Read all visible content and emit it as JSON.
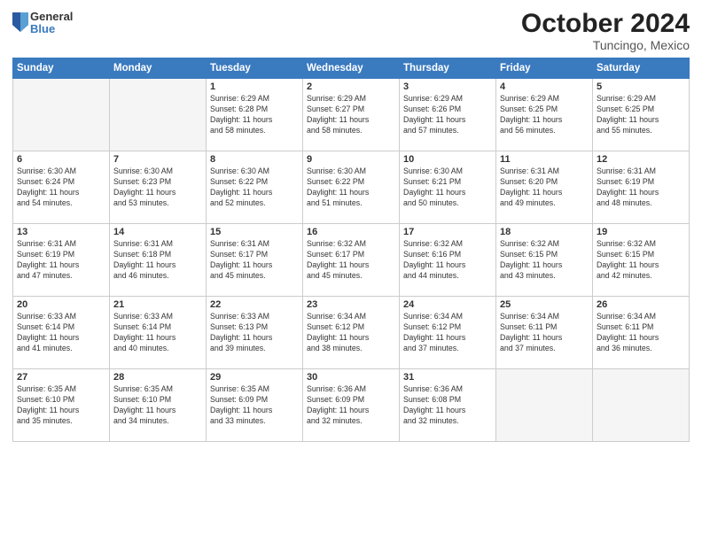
{
  "logo": {
    "general": "General",
    "blue": "Blue"
  },
  "title": "October 2024",
  "location": "Tuncingo, Mexico",
  "days_header": [
    "Sunday",
    "Monday",
    "Tuesday",
    "Wednesday",
    "Thursday",
    "Friday",
    "Saturday"
  ],
  "weeks": [
    [
      {
        "day": "",
        "info": ""
      },
      {
        "day": "",
        "info": ""
      },
      {
        "day": "1",
        "info": "Sunrise: 6:29 AM\nSunset: 6:28 PM\nDaylight: 11 hours\nand 58 minutes."
      },
      {
        "day": "2",
        "info": "Sunrise: 6:29 AM\nSunset: 6:27 PM\nDaylight: 11 hours\nand 58 minutes."
      },
      {
        "day": "3",
        "info": "Sunrise: 6:29 AM\nSunset: 6:26 PM\nDaylight: 11 hours\nand 57 minutes."
      },
      {
        "day": "4",
        "info": "Sunrise: 6:29 AM\nSunset: 6:25 PM\nDaylight: 11 hours\nand 56 minutes."
      },
      {
        "day": "5",
        "info": "Sunrise: 6:29 AM\nSunset: 6:25 PM\nDaylight: 11 hours\nand 55 minutes."
      }
    ],
    [
      {
        "day": "6",
        "info": "Sunrise: 6:30 AM\nSunset: 6:24 PM\nDaylight: 11 hours\nand 54 minutes."
      },
      {
        "day": "7",
        "info": "Sunrise: 6:30 AM\nSunset: 6:23 PM\nDaylight: 11 hours\nand 53 minutes."
      },
      {
        "day": "8",
        "info": "Sunrise: 6:30 AM\nSunset: 6:22 PM\nDaylight: 11 hours\nand 52 minutes."
      },
      {
        "day": "9",
        "info": "Sunrise: 6:30 AM\nSunset: 6:22 PM\nDaylight: 11 hours\nand 51 minutes."
      },
      {
        "day": "10",
        "info": "Sunrise: 6:30 AM\nSunset: 6:21 PM\nDaylight: 11 hours\nand 50 minutes."
      },
      {
        "day": "11",
        "info": "Sunrise: 6:31 AM\nSunset: 6:20 PM\nDaylight: 11 hours\nand 49 minutes."
      },
      {
        "day": "12",
        "info": "Sunrise: 6:31 AM\nSunset: 6:19 PM\nDaylight: 11 hours\nand 48 minutes."
      }
    ],
    [
      {
        "day": "13",
        "info": "Sunrise: 6:31 AM\nSunset: 6:19 PM\nDaylight: 11 hours\nand 47 minutes."
      },
      {
        "day": "14",
        "info": "Sunrise: 6:31 AM\nSunset: 6:18 PM\nDaylight: 11 hours\nand 46 minutes."
      },
      {
        "day": "15",
        "info": "Sunrise: 6:31 AM\nSunset: 6:17 PM\nDaylight: 11 hours\nand 45 minutes."
      },
      {
        "day": "16",
        "info": "Sunrise: 6:32 AM\nSunset: 6:17 PM\nDaylight: 11 hours\nand 45 minutes."
      },
      {
        "day": "17",
        "info": "Sunrise: 6:32 AM\nSunset: 6:16 PM\nDaylight: 11 hours\nand 44 minutes."
      },
      {
        "day": "18",
        "info": "Sunrise: 6:32 AM\nSunset: 6:15 PM\nDaylight: 11 hours\nand 43 minutes."
      },
      {
        "day": "19",
        "info": "Sunrise: 6:32 AM\nSunset: 6:15 PM\nDaylight: 11 hours\nand 42 minutes."
      }
    ],
    [
      {
        "day": "20",
        "info": "Sunrise: 6:33 AM\nSunset: 6:14 PM\nDaylight: 11 hours\nand 41 minutes."
      },
      {
        "day": "21",
        "info": "Sunrise: 6:33 AM\nSunset: 6:14 PM\nDaylight: 11 hours\nand 40 minutes."
      },
      {
        "day": "22",
        "info": "Sunrise: 6:33 AM\nSunset: 6:13 PM\nDaylight: 11 hours\nand 39 minutes."
      },
      {
        "day": "23",
        "info": "Sunrise: 6:34 AM\nSunset: 6:12 PM\nDaylight: 11 hours\nand 38 minutes."
      },
      {
        "day": "24",
        "info": "Sunrise: 6:34 AM\nSunset: 6:12 PM\nDaylight: 11 hours\nand 37 minutes."
      },
      {
        "day": "25",
        "info": "Sunrise: 6:34 AM\nSunset: 6:11 PM\nDaylight: 11 hours\nand 37 minutes."
      },
      {
        "day": "26",
        "info": "Sunrise: 6:34 AM\nSunset: 6:11 PM\nDaylight: 11 hours\nand 36 minutes."
      }
    ],
    [
      {
        "day": "27",
        "info": "Sunrise: 6:35 AM\nSunset: 6:10 PM\nDaylight: 11 hours\nand 35 minutes."
      },
      {
        "day": "28",
        "info": "Sunrise: 6:35 AM\nSunset: 6:10 PM\nDaylight: 11 hours\nand 34 minutes."
      },
      {
        "day": "29",
        "info": "Sunrise: 6:35 AM\nSunset: 6:09 PM\nDaylight: 11 hours\nand 33 minutes."
      },
      {
        "day": "30",
        "info": "Sunrise: 6:36 AM\nSunset: 6:09 PM\nDaylight: 11 hours\nand 32 minutes."
      },
      {
        "day": "31",
        "info": "Sunrise: 6:36 AM\nSunset: 6:08 PM\nDaylight: 11 hours\nand 32 minutes."
      },
      {
        "day": "",
        "info": ""
      },
      {
        "day": "",
        "info": ""
      }
    ]
  ]
}
